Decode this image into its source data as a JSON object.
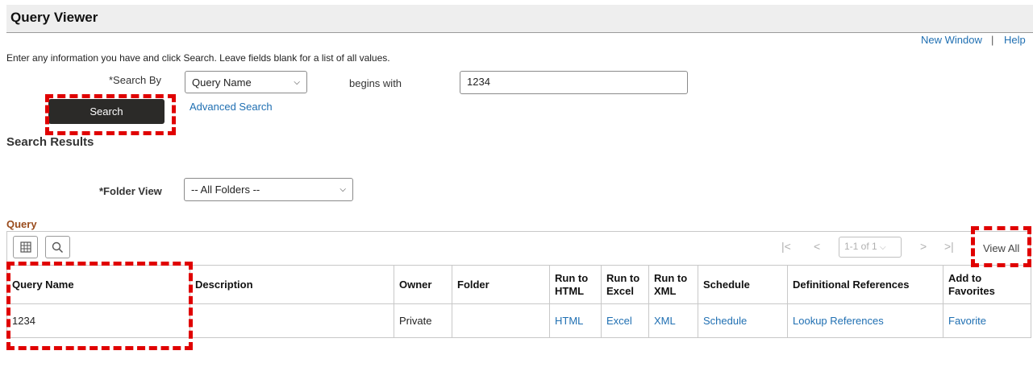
{
  "header": {
    "title": "Query Viewer"
  },
  "top_links": {
    "new_window": "New Window",
    "separator": "|",
    "help": "Help"
  },
  "instructions": "Enter any information you have and click Search. Leave fields blank for a list of all values.",
  "search": {
    "search_by_label": "*Search By",
    "search_by_value": "Query Name",
    "operator": "begins with",
    "value": "1234",
    "search_button": "Search",
    "advanced_link": "Advanced Search"
  },
  "results": {
    "title": "Search Results",
    "folder_view_label": "*Folder View",
    "folder_view_value": "-- All Folders --"
  },
  "grid": {
    "title": "Query",
    "pager": "1-1 of 1",
    "view_all": "View All",
    "columns": [
      "Query Name",
      "Description",
      "Owner",
      "Folder",
      "Run to HTML",
      "Run to Excel",
      "Run to XML",
      "Schedule",
      "Definitional References",
      "Add to Favorites"
    ],
    "column_lines": [
      [
        "Query Name"
      ],
      [
        "Description"
      ],
      [
        "Owner"
      ],
      [
        "Folder"
      ],
      [
        "Run to",
        "HTML"
      ],
      [
        "Run to",
        "Excel"
      ],
      [
        "Run to",
        "XML"
      ],
      [
        "Schedule"
      ],
      [
        "Definitional References"
      ],
      [
        "Add to",
        "Favorites"
      ]
    ],
    "rows": [
      {
        "query_name": "1234",
        "description": "",
        "owner": "Private",
        "folder": "",
        "run_html": "HTML",
        "run_excel": "Excel",
        "run_xml": "XML",
        "schedule": "Schedule",
        "references": "Lookup References",
        "favorite": "Favorite"
      }
    ]
  },
  "colors": {
    "link": "#1f6fb2",
    "highlight": "#e00000",
    "grid_title": "#9a4c1d",
    "button": "#2b2a28"
  }
}
